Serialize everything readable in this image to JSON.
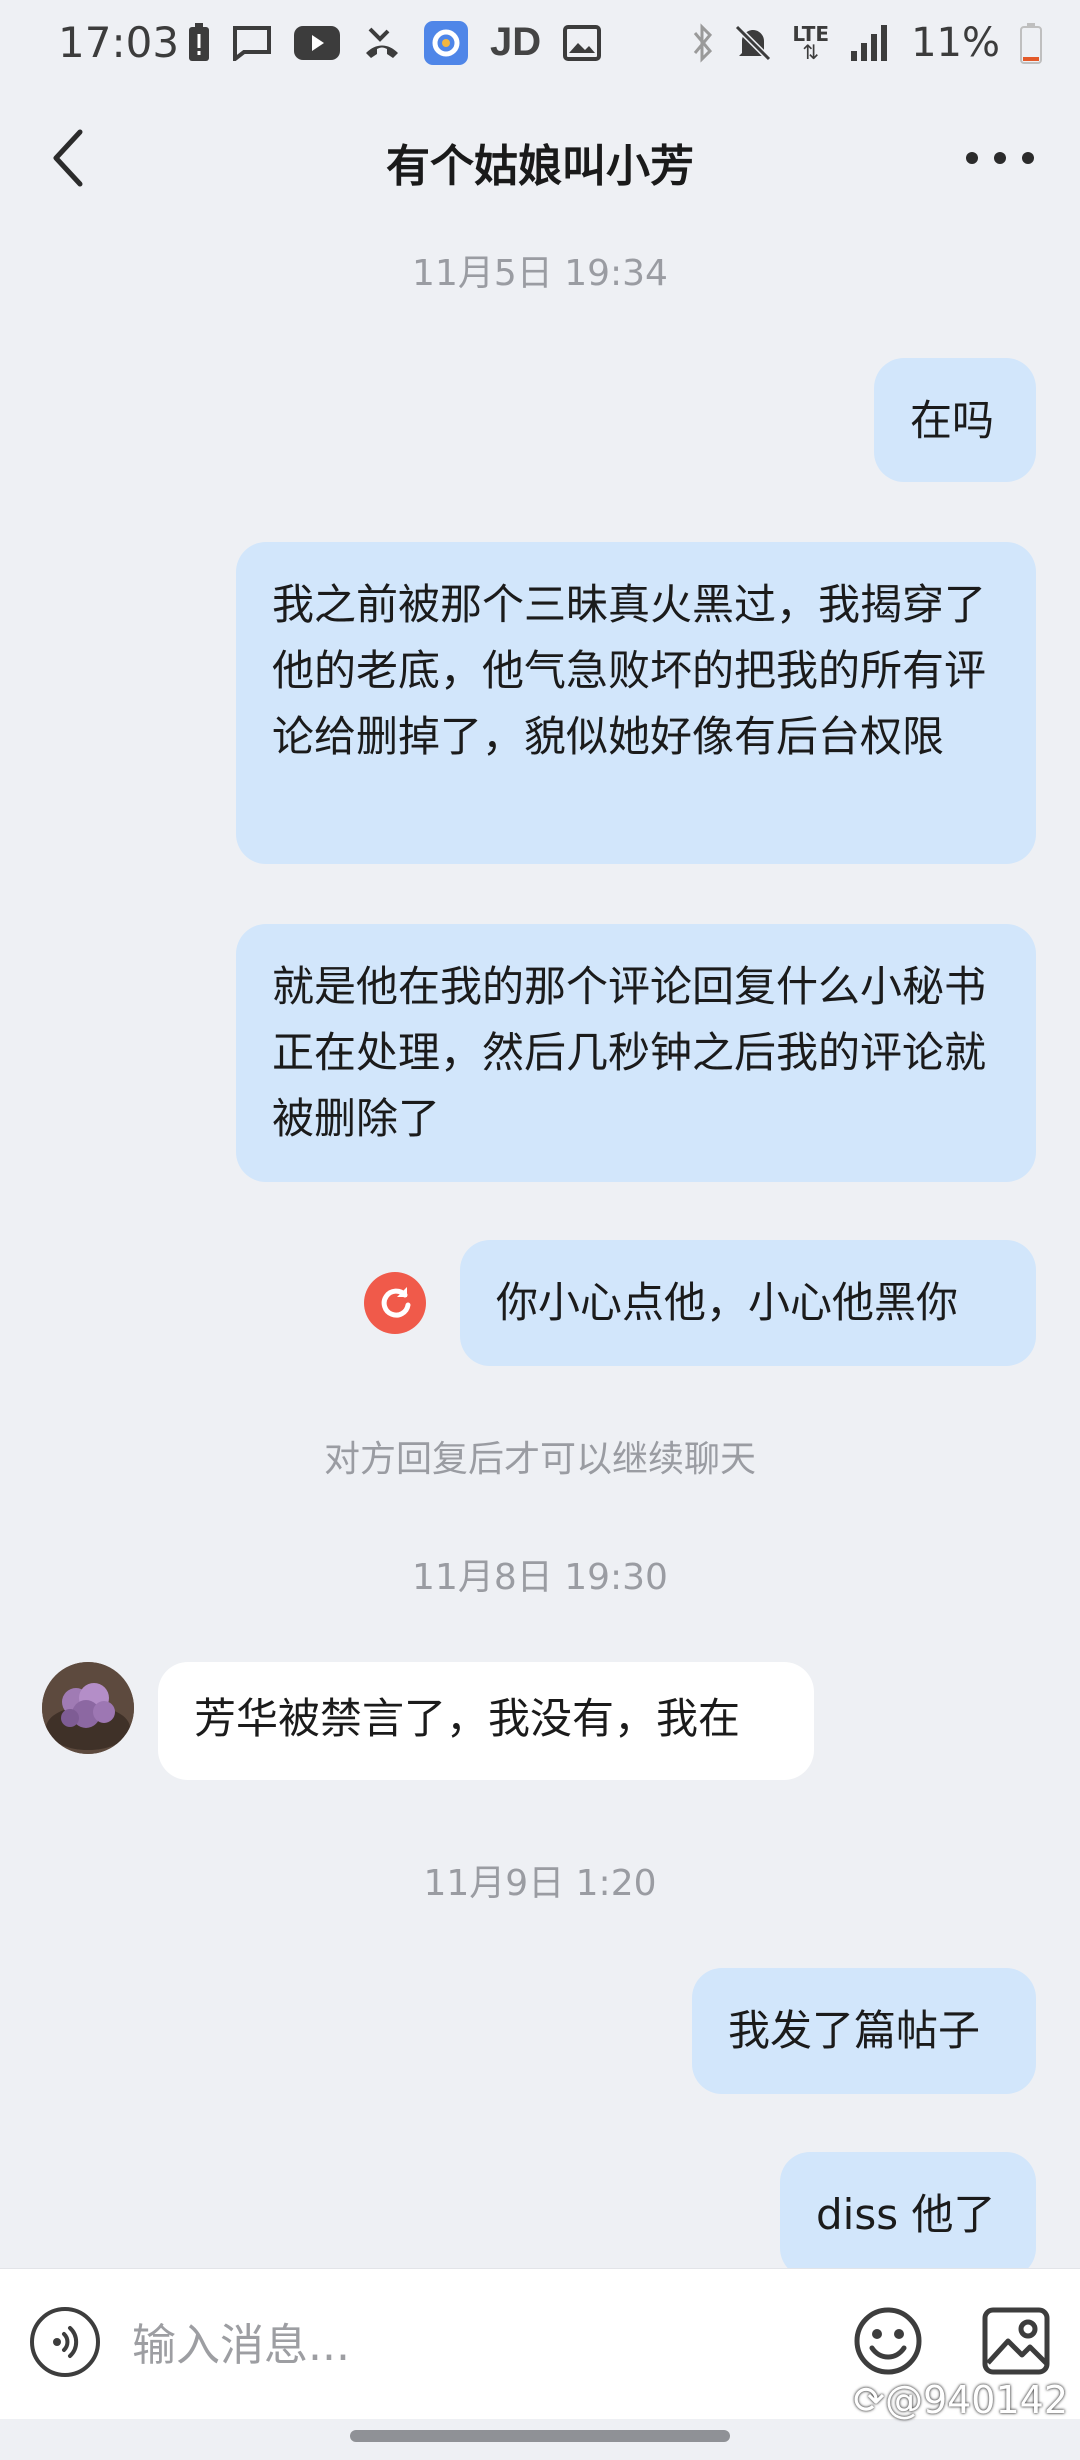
{
  "status_bar": {
    "time": "17:03",
    "left_icons": [
      "battery-alert-icon",
      "message-icon",
      "youtube-icon",
      "missed-call-icon",
      "app-icon",
      "jd-icon",
      "image-icon"
    ],
    "jd_label": "JD",
    "right_icons": [
      "bluetooth-icon",
      "mute-icon",
      "lte-icon",
      "signal-icon",
      "battery-icon"
    ],
    "lte_label": "LTE",
    "battery": "11%"
  },
  "nav": {
    "title": "有个姑娘叫小芳"
  },
  "messages": {
    "ts1": "11月5日 19:34",
    "m1": "在吗",
    "m2": "我之前被那个三昧真火黑过，我揭穿了他的老底，他气急败坏的把我的所有评论给删掉了，貌似她好像有后台权限",
    "m3": "就是他在我的那个评论回复什么小秘书正在处理，然后几秒钟之后我的评论就被删除了",
    "m4": "你小心点他，小心他黑你",
    "system_note": "对方回复后才可以继续聊天",
    "ts2": "11月8日 19:30",
    "m5": "芳华被禁言了，我没有，我在",
    "ts3": "11月9日 1:20",
    "m6": "我发了篇帖子",
    "m7": "diss 他了"
  },
  "input_bar": {
    "placeholder": "输入消息..."
  },
  "watermark": "@940142",
  "colors": {
    "background": "#eef0f4",
    "my_bubble": "#d2e6fb",
    "other_bubble": "#ffffff",
    "retry_red": "#f05a4a",
    "timestamp": "#9a9ca2"
  }
}
